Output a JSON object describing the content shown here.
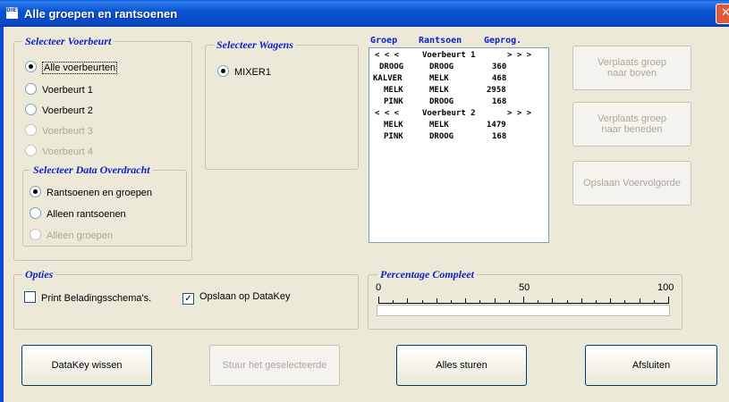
{
  "window": {
    "title": "Alle groepen en rantsoenen",
    "icon_text": "DIET"
  },
  "voerbeurt_group": {
    "legend": "Selecteer Voerbeurt",
    "options": [
      {
        "label": "Alle voerbeurten",
        "selected": true,
        "enabled": true
      },
      {
        "label": "Voerbeurt 1",
        "selected": false,
        "enabled": true
      },
      {
        "label": "Voerbeurt 2",
        "selected": false,
        "enabled": true
      },
      {
        "label": "Voerbeurt 3",
        "selected": false,
        "enabled": false
      },
      {
        "label": "Voerbeurt 4",
        "selected": false,
        "enabled": false
      }
    ]
  },
  "data_group": {
    "legend": "Selecteer Data Overdracht",
    "options": [
      {
        "label": "Rantsoenen en groepen",
        "selected": true,
        "enabled": true
      },
      {
        "label": "Alleen rantsoenen",
        "selected": false,
        "enabled": true
      },
      {
        "label": "Alleen groepen",
        "selected": false,
        "enabled": false
      }
    ]
  },
  "wagens_group": {
    "legend": "Selecteer Wagens",
    "options": [
      {
        "label": "MIXER1",
        "selected": true
      }
    ]
  },
  "list": {
    "headers": {
      "groep": "Groep",
      "rantsoen": "Rantsoen",
      "geprog": "Geprog."
    },
    "rows": [
      {
        "a": "< < <",
        "b": "Voerbeurt 1",
        "c": "> > >"
      },
      {
        "a": "DROOG",
        "b": "DROOG",
        "c": "360"
      },
      {
        "a": "KALVER",
        "b": "MELK",
        "c": "468"
      },
      {
        "a": "MELK",
        "b": "MELK",
        "c": "2958"
      },
      {
        "a": "PINK",
        "b": "DROOG",
        "c": "168"
      },
      {
        "a": "< < <",
        "b": "Voerbeurt 2",
        "c": "> > >"
      },
      {
        "a": "MELK",
        "b": "MELK",
        "c": "1479"
      },
      {
        "a": "PINK",
        "b": "DROOG",
        "c": "168"
      }
    ]
  },
  "side_buttons": {
    "up": "Verplaats groep naar boven",
    "down": "Verplaats groep naar beneden",
    "save_order": "Opslaan Voervolgorde"
  },
  "opties": {
    "legend": "Opties",
    "print": {
      "label": "Print Beladingsschema's.",
      "checked": false
    },
    "save": {
      "label": "Opslaan op DataKey",
      "checked": true
    }
  },
  "progress": {
    "legend": "Percentage Compleet",
    "tick_labels": [
      "0",
      "50",
      "100"
    ],
    "value": 0
  },
  "bottom_buttons": {
    "wipe": "DataKey wissen",
    "send_selected": "Stuur het geselecteerde",
    "send_all": "Alles sturen",
    "close": "Afsluiten"
  }
}
